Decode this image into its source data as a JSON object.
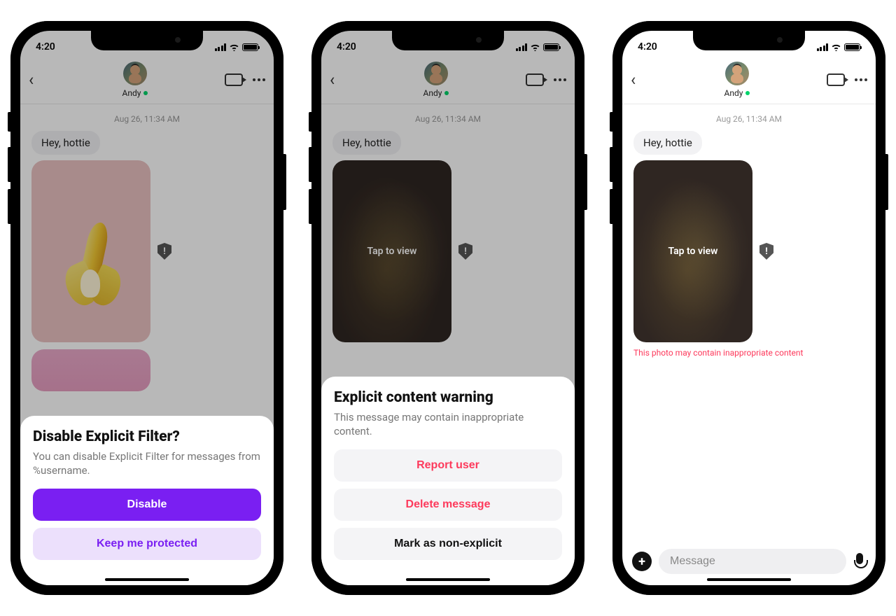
{
  "status": {
    "time": "4:20"
  },
  "header": {
    "contact_name": "Andy"
  },
  "chat": {
    "timestamp": "Aug 26, 11:34 AM",
    "greeting": "Hey, hottie",
    "tap_to_view": "Tap to view",
    "warning_caption": "This photo may contain inappropriate content"
  },
  "sheet1": {
    "title": "Disable Explicit Filter?",
    "body": "You can disable Explicit Filter for messages from %username.",
    "primary": "Disable",
    "secondary": "Keep me protected"
  },
  "sheet2": {
    "title": "Explicit content warning",
    "body": "This message may contain inappropriate content.",
    "report": "Report user",
    "delete": "Delete message",
    "mark": "Mark as non-explicit"
  },
  "composer": {
    "placeholder": "Message"
  }
}
